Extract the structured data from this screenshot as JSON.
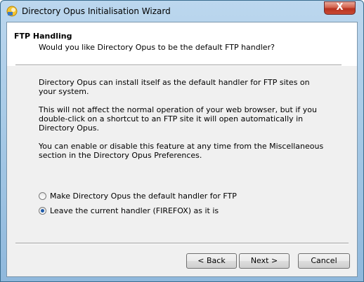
{
  "window": {
    "title": "Directory Opus Initialisation Wizard",
    "close_label": "X"
  },
  "header": {
    "title": "FTP Handling",
    "subtitle": "Would you like Directory Opus to be the default FTP handler?"
  },
  "body": {
    "paragraphs": [
      "Directory Opus can install itself as the default handler for FTP sites on your system.",
      "This will not affect the normal operation of your web browser, but if you double-click on a shortcut to an FTP site it will open automatically in Directory Opus.",
      "You can enable or disable this feature at any time from the Miscellaneous section in the Directory Opus Preferences."
    ]
  },
  "options": [
    {
      "label": "Make Directory Opus the default handler for FTP",
      "selected": false
    },
    {
      "label": "Leave the current handler (FIREFOX) as it is",
      "selected": true
    }
  ],
  "buttons": {
    "back": "< Back",
    "next": "Next >",
    "cancel": "Cancel"
  },
  "colors": {
    "title_bar": "#a9cbe7",
    "close_button": "#c84a34",
    "dialog_background": "#f0f0f0",
    "radio_dot": "#1e5aa8"
  },
  "icons": {
    "app_icon": "directory-opus-app-icon"
  }
}
